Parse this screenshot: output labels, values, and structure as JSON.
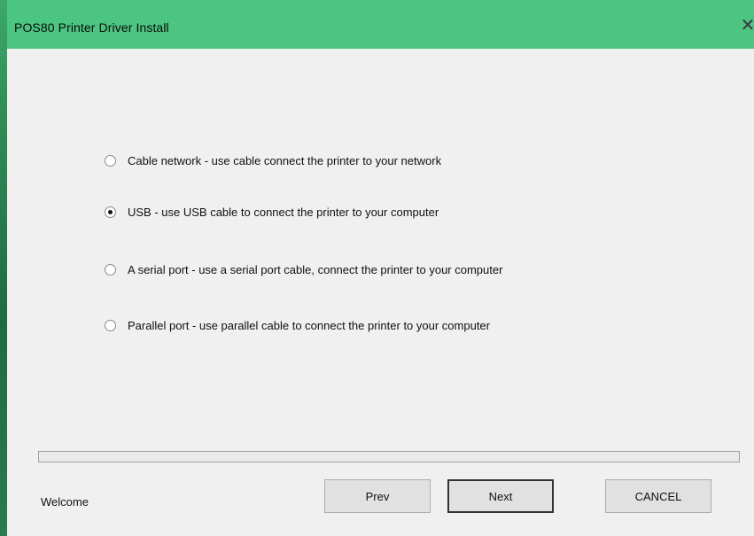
{
  "window": {
    "title": "POS80 Printer Driver Install",
    "close_glyph": "✕",
    "titlebar_color": "#4cc580"
  },
  "options": [
    {
      "label": "Cable network - use cable connect the printer to your network",
      "selected": false
    },
    {
      "label": "USB - use USB cable to connect the printer to your computer",
      "selected": true
    },
    {
      "label": "A serial port - use a serial port cable, connect the printer to your computer",
      "selected": false
    },
    {
      "label": "Parallel port - use parallel cable to connect the printer to your computer",
      "selected": false
    }
  ],
  "progress": {
    "value": 0
  },
  "status": "Welcome",
  "buttons": {
    "prev": "Prev",
    "next": "Next",
    "cancel": "CANCEL"
  }
}
